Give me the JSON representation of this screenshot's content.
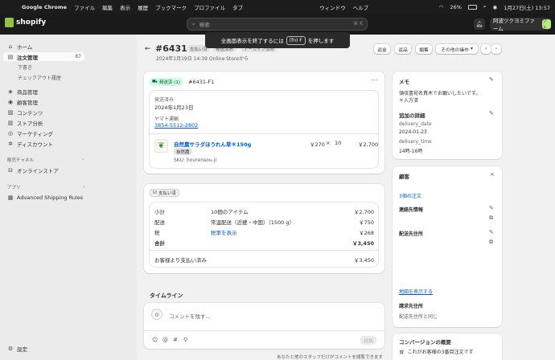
{
  "menubar": {
    "apple": "",
    "app": "Google Chrome",
    "items": [
      "ファイル",
      "編集",
      "表示",
      "履歴",
      "ブックマーク",
      "プロファイル",
      "タブ",
      "ウィンドウ",
      "ヘルプ"
    ],
    "battery": "26%",
    "datetime": "1月27日(土) 13:57"
  },
  "topbar": {
    "logo": "shopify",
    "search_placeholder": "検索",
    "search_shortcut": "⌘ K",
    "store_name": "阿波ツクヨミファーム",
    "store_initials": "ツト"
  },
  "toast": {
    "before": "全画面表示を終了するには",
    "key": "(fn) F",
    "after": "を押します"
  },
  "sidebar": {
    "items": [
      {
        "icon": "home-icon",
        "glyph": "⌂",
        "label": "ホーム"
      },
      {
        "icon": "orders-icon",
        "glyph": "▤",
        "label": "注文管理",
        "badge": "87"
      }
    ],
    "subitems": [
      "下書き",
      "チェックアウト履歴"
    ],
    "items2": [
      {
        "icon": "tag-icon",
        "glyph": "◈",
        "label": "商品管理"
      },
      {
        "icon": "customer-icon",
        "glyph": "◉",
        "label": "顧客管理"
      },
      {
        "icon": "content-icon",
        "glyph": "▧",
        "label": "コンテンツ"
      },
      {
        "icon": "analytics-icon",
        "glyph": "▥",
        "label": "ストア分析"
      },
      {
        "icon": "marketing-icon",
        "glyph": "◎",
        "label": "マーケティング"
      },
      {
        "icon": "discount-icon",
        "glyph": "✲",
        "label": "ディスカウント"
      }
    ],
    "channels_title": "販売チャネル",
    "online_store": "オンラインストア",
    "apps_title": "アプリ",
    "app_item": "Advanced Shipping Rules",
    "settings": "設定"
  },
  "order": {
    "back": "←",
    "number": "#6431",
    "badge1": "支払い済",
    "badge2": "発送済み",
    "badge3": "アーカイブ済み",
    "meta": "2024年1月19日 14:39 Online Storeから",
    "actions": {
      "refund": "返金",
      "return": "返品",
      "edit": "編集",
      "more": "その他の操作",
      "more_caret": "▾",
      "prev": "‹",
      "next": "›"
    }
  },
  "fulfillment": {
    "badge": "発送済 (1)",
    "id": "#6431-F1",
    "status": "発送済み",
    "date": "2024年1月23日",
    "carrier": "ヤマト運輸",
    "tracking": "3854-5512-2802",
    "item": {
      "name": "自然農サラダほうれん草＊150g",
      "tag": "自然農",
      "sku": "SKU: hourensou-ji",
      "price": "￥270",
      "times": "×",
      "qty": "10",
      "total": "￥2,700"
    }
  },
  "payment": {
    "badge": "支払い済",
    "rows": [
      {
        "label": "小計",
        "desc": "10個のアイテム",
        "value": "￥2,700"
      },
      {
        "label": "配送",
        "desc": "常温配送（近畿・中国）（1500 g）",
        "value": "￥750"
      },
      {
        "label": "税",
        "desc": "税率を表示",
        "value": "￥268"
      }
    ],
    "total_label": "合計",
    "total_value": "￥3,450",
    "paid_label": "お客様より支払い済み",
    "paid_value": "￥3,450"
  },
  "timeline": {
    "title": "タイムライン",
    "placeholder": "コメントを残す...",
    "post": "投稿",
    "footer": "あなたと他のスタッフだけがコメントを閲覧できます"
  },
  "notes": {
    "title": "メモ",
    "text": "領収書宛名貴木でお願いしたいです。",
    "text2": "＊入方済",
    "extra_title": "追加の詳細",
    "k1": "delivery_date",
    "v1": "2024-01-23",
    "k2": "delivery_time",
    "v2": "14時-16時"
  },
  "customer": {
    "title": "顧客",
    "orders": "3個の注文",
    "contact": "連絡先情報",
    "shipping": "配送先住所",
    "map": "地図を表示する",
    "billing": "請求先住所",
    "billing_value": "配送先住所と同じ"
  },
  "conversion": {
    "title": "コンバージョンの概要",
    "text": "これがお客様の3番目注文です"
  }
}
